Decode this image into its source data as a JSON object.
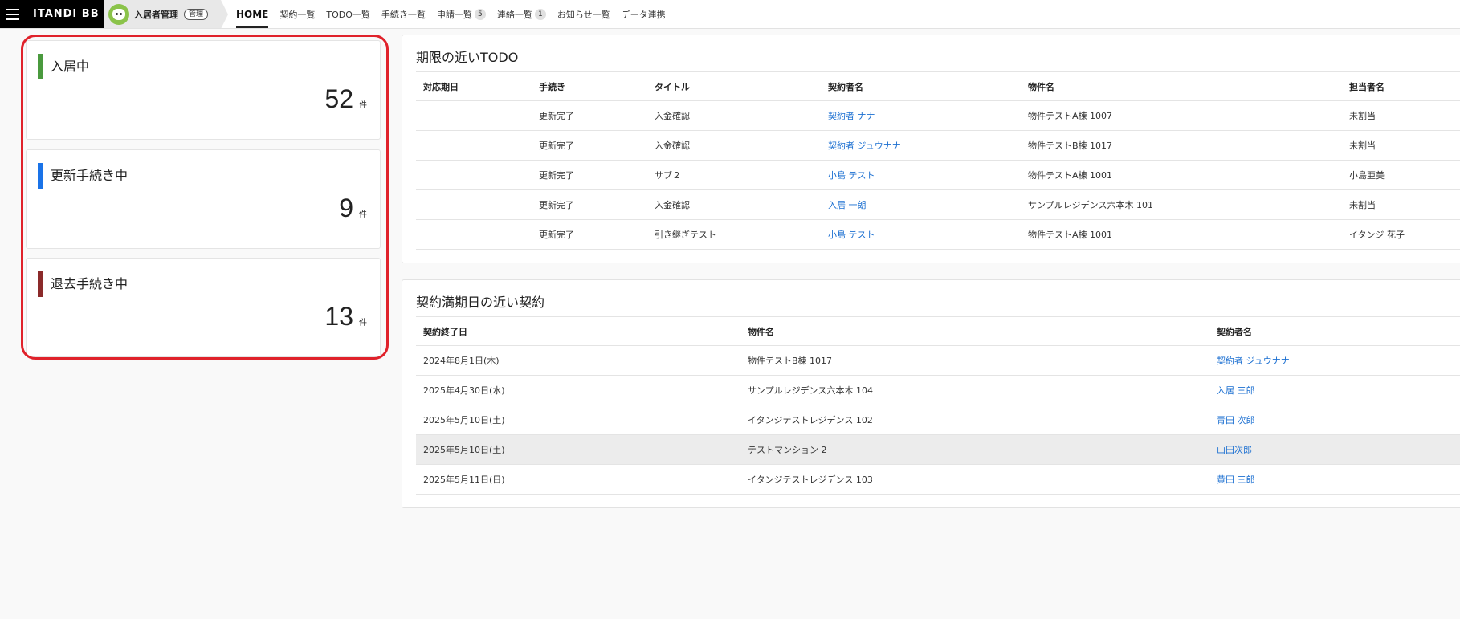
{
  "header": {
    "brand": "ITANDI BB",
    "app_name": "入居者管理",
    "app_badge": "管理",
    "nav": [
      {
        "label": "HOME",
        "active": true
      },
      {
        "label": "契約一覧"
      },
      {
        "label": "TODO一覧"
      },
      {
        "label": "手続き一覧"
      },
      {
        "label": "申請一覧",
        "count": "5"
      },
      {
        "label": "連絡一覧",
        "count": "1"
      },
      {
        "label": "お知らせ一覧"
      },
      {
        "label": "データ連携"
      }
    ]
  },
  "status_cards": [
    {
      "label": "入居中",
      "value": "52",
      "unit": "件",
      "color": "#4a9a3e"
    },
    {
      "label": "更新手続き中",
      "value": "9",
      "unit": "件",
      "color": "#1a73e8"
    },
    {
      "label": "退去手続き中",
      "value": "13",
      "unit": "件",
      "color": "#8b2a2a"
    }
  ],
  "highlight_color": "#e0222b",
  "link_color": "#1b6fd1",
  "todo": {
    "title": "期限の近いTODO",
    "columns": [
      "対応期日",
      "手続き",
      "タイトル",
      "契約者名",
      "物件名",
      "担当者名"
    ],
    "rows": [
      {
        "due": "",
        "procedure": "更新完了",
        "title": "入金確認",
        "contractor": "契約者 ナナ",
        "property": "物件テストA棟 1007",
        "assignee": "未割当"
      },
      {
        "due": "",
        "procedure": "更新完了",
        "title": "入金確認",
        "contractor": "契約者 ジュウナナ",
        "property": "物件テストB棟 1017",
        "assignee": "未割当"
      },
      {
        "due": "",
        "procedure": "更新完了",
        "title": "サブ２",
        "contractor": "小島 テスト",
        "property": "物件テストA棟 1001",
        "assignee": "小島亜美"
      },
      {
        "due": "",
        "procedure": "更新完了",
        "title": "入金確認",
        "contractor": "入居 一朗",
        "property": "サンプルレジデンス六本木 101",
        "assignee": "未割当"
      },
      {
        "due": "",
        "procedure": "更新完了",
        "title": "引き継ぎテスト",
        "contractor": "小島 テスト",
        "property": "物件テストA棟 1001",
        "assignee": "イタンジ 花子"
      }
    ]
  },
  "contracts": {
    "title": "契約満期日の近い契約",
    "columns": [
      "契約終了日",
      "物件名",
      "契約者名"
    ],
    "rows": [
      {
        "end_date": "2024年8月1日(木)",
        "property": "物件テストB棟 1017",
        "contractor": "契約者 ジュウナナ"
      },
      {
        "end_date": "2025年4月30日(水)",
        "property": "サンプルレジデンス六本木 104",
        "contractor": "入居 三郎"
      },
      {
        "end_date": "2025年5月10日(土)",
        "property": "イタンジテストレジデンス 102",
        "contractor": "青田 次郎"
      },
      {
        "end_date": "2025年5月10日(土)",
        "property": "テストマンション 2",
        "contractor": "山田次郎",
        "highlighted": true
      },
      {
        "end_date": "2025年5月11日(日)",
        "property": "イタンジテストレジデンス 103",
        "contractor": "黄田 三郎"
      }
    ]
  }
}
